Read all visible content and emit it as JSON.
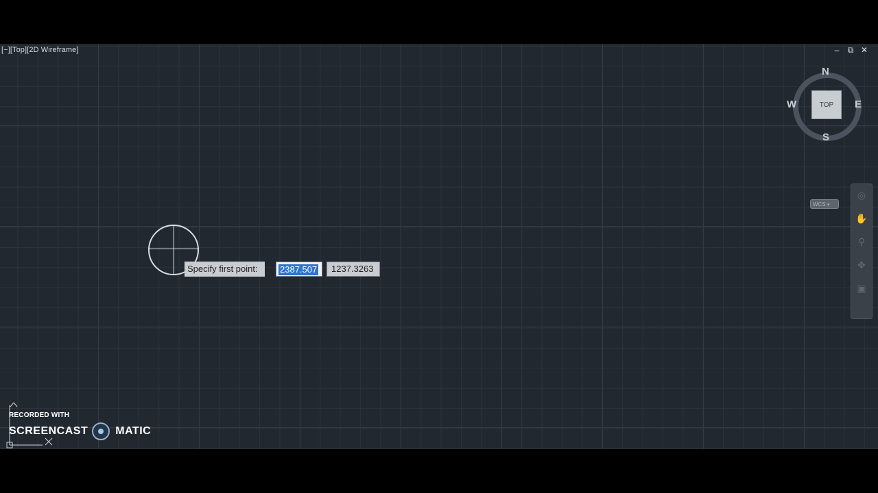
{
  "viewport": {
    "label": "[−][Top][2D Wireframe]"
  },
  "window_controls": {
    "minimize": "–",
    "restore": "⧉",
    "close": "✕"
  },
  "viewcube": {
    "north": "N",
    "south": "S",
    "east": "E",
    "west": "W",
    "face": "TOP",
    "ucs_menu": "WCS"
  },
  "dynamic_input": {
    "prompt": "Specify first point:",
    "x_value": "2387.507",
    "y_value": "1237.3263"
  },
  "watermark": {
    "line1": "RECORDED WITH",
    "brand_left": "SCREENCAST",
    "brand_right": "MATIC"
  },
  "colors": {
    "background": "#212830",
    "selection": "#2f74d0"
  }
}
